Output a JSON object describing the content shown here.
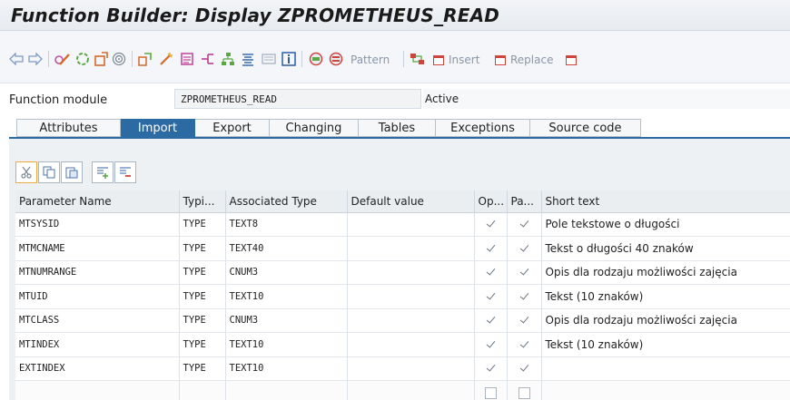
{
  "window": {
    "title": "Function Builder: Display ZPROMETHEUS_READ"
  },
  "toolbar": {
    "pattern_label": "Pattern",
    "insert_label": "Insert",
    "replace_label": "Replace"
  },
  "header": {
    "function_module_label": "Function module",
    "function_module_value": "ZPROMETHEUS_READ",
    "status": "Active"
  },
  "tabs": [
    {
      "label": "Attributes",
      "active": false
    },
    {
      "label": "Import",
      "active": true
    },
    {
      "label": "Export",
      "active": false
    },
    {
      "label": "Changing",
      "active": false
    },
    {
      "label": "Tables",
      "active": false
    },
    {
      "label": "Exceptions",
      "active": false
    },
    {
      "label": "Source code",
      "active": false
    }
  ],
  "grid": {
    "columns": [
      "Parameter Name",
      "Typi...",
      "Associated Type",
      "Default value",
      "Op...",
      "Pa...",
      "Short text"
    ],
    "rows": [
      {
        "name": "MTSYSID",
        "typing": "TYPE",
        "assoc_type": "TEXT8",
        "default": "",
        "optional": true,
        "pass_value": true,
        "short_text": "Pole tekstowe o długości"
      },
      {
        "name": "MTMCNAME",
        "typing": "TYPE",
        "assoc_type": "TEXT40",
        "default": "",
        "optional": true,
        "pass_value": true,
        "short_text": "Tekst o długości 40 znaków"
      },
      {
        "name": "MTNUMRANGE",
        "typing": "TYPE",
        "assoc_type": "CNUM3",
        "default": "",
        "optional": true,
        "pass_value": true,
        "short_text": "Opis dla rodzaju możliwości zajęcia"
      },
      {
        "name": "MTUID",
        "typing": "TYPE",
        "assoc_type": "TEXT10",
        "default": "",
        "optional": true,
        "pass_value": true,
        "short_text": "Tekst (10 znaków)"
      },
      {
        "name": "MTCLASS",
        "typing": "TYPE",
        "assoc_type": "CNUM3",
        "default": "",
        "optional": true,
        "pass_value": true,
        "short_text": "Opis dla rodzaju możliwości zajęcia"
      },
      {
        "name": "MTINDEX",
        "typing": "TYPE",
        "assoc_type": "TEXT10",
        "default": "",
        "optional": true,
        "pass_value": true,
        "short_text": "Tekst (10 znaków)"
      },
      {
        "name": "EXTINDEX",
        "typing": "TYPE",
        "assoc_type": "TEXT10",
        "default": "",
        "optional": true,
        "pass_value": true,
        "short_text": ""
      },
      {
        "name": "",
        "typing": "",
        "assoc_type": "",
        "default": "",
        "optional": false,
        "pass_value": false,
        "short_text": ""
      }
    ]
  },
  "colors": {
    "accent": "#2b6aa3",
    "check": "#6b7480"
  }
}
